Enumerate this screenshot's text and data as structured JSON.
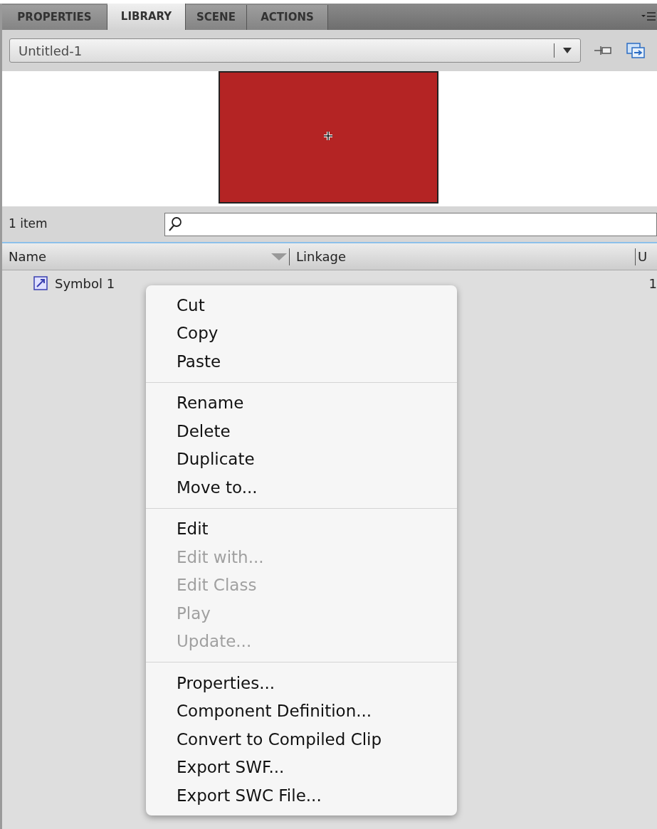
{
  "tabs": [
    {
      "label": "PROPERTIES",
      "selected": false
    },
    {
      "label": "LIBRARY",
      "selected": true
    },
    {
      "label": "SCENE",
      "selected": false
    },
    {
      "label": "ACTIONS",
      "selected": false
    }
  ],
  "document_dropdown": {
    "value": "Untitled-1"
  },
  "item_count": "1 item",
  "columns": [
    "Name",
    "Linkage",
    "U"
  ],
  "rows": [
    {
      "name": "Symbol 1",
      "linkage": "",
      "column_3": "1"
    }
  ],
  "context_menu": [
    [
      {
        "label": "Cut",
        "disabled": false
      },
      {
        "label": "Copy",
        "disabled": false
      },
      {
        "label": "Paste",
        "disabled": false
      }
    ],
    [
      {
        "label": "Rename",
        "disabled": false
      },
      {
        "label": "Delete",
        "disabled": false
      },
      {
        "label": "Duplicate",
        "disabled": false
      },
      {
        "label": "Move to...",
        "disabled": false
      }
    ],
    [
      {
        "label": "Edit",
        "disabled": false
      },
      {
        "label": "Edit with...",
        "disabled": true
      },
      {
        "label": "Edit Class",
        "disabled": true
      },
      {
        "label": "Play",
        "disabled": true
      },
      {
        "label": "Update...",
        "disabled": true
      }
    ],
    [
      {
        "label": "Properties...",
        "disabled": false
      },
      {
        "label": "Component Definition...",
        "disabled": false
      },
      {
        "label": "Convert to Compiled Clip",
        "disabled": false
      },
      {
        "label": "Export SWF...",
        "disabled": false
      },
      {
        "label": "Export SWC File...",
        "disabled": false
      }
    ]
  ]
}
